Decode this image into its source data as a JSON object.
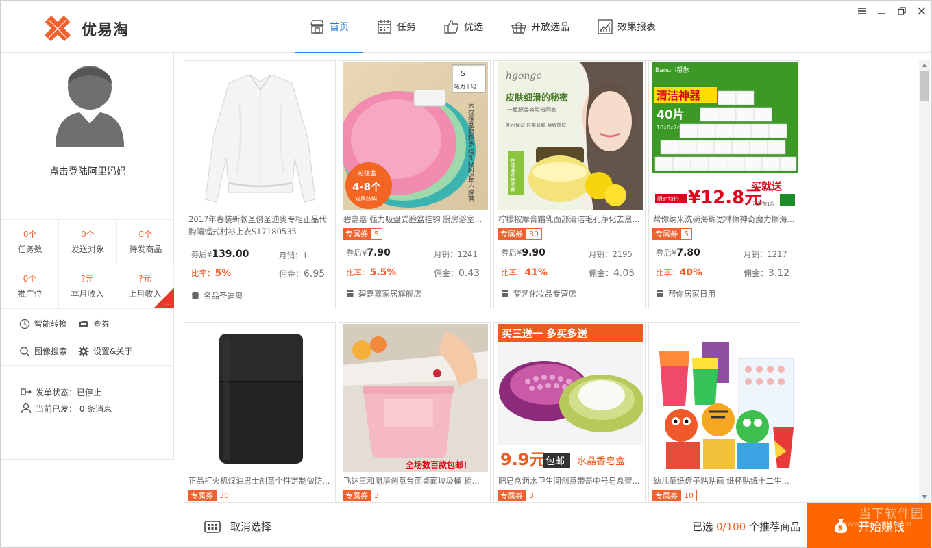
{
  "app": {
    "name": "优易淘",
    "brand_color": "#f0612d",
    "accent_color": "#2c7bd6"
  },
  "nav": [
    {
      "label": "首页",
      "icon": "store-icon",
      "active": true
    },
    {
      "label": "任务",
      "icon": "calendar-icon",
      "active": false
    },
    {
      "label": "优选",
      "icon": "thumbs-up-icon",
      "active": false
    },
    {
      "label": "开放选品",
      "icon": "basket-icon",
      "active": false
    },
    {
      "label": "效果报表",
      "icon": "chart-report-icon",
      "active": false
    }
  ],
  "window_controls": [
    "menu-icon",
    "minimize-icon",
    "restore-icon",
    "close-icon"
  ],
  "user": {
    "login_prompt": "点击登陆阿里妈妈"
  },
  "stats": [
    {
      "value": "0个",
      "label": "任务数"
    },
    {
      "value": "0个",
      "label": "发送对象"
    },
    {
      "value": "0个",
      "label": "待发商品"
    },
    {
      "value": "0个",
      "label": "推广位"
    },
    {
      "value": "?元",
      "label": "本月收入"
    },
    {
      "value": "?元",
      "label": "上月收入"
    }
  ],
  "corner_more": "...",
  "tools": [
    {
      "label": "智能转换",
      "icon": "clock-icon"
    },
    {
      "label": "查券",
      "icon": "ticket-icon"
    },
    {
      "label": "图像搜索",
      "icon": "search-icon"
    },
    {
      "label": "设置&关于",
      "icon": "gear-icon"
    }
  ],
  "status": {
    "send_state": "发单状态：已停止",
    "sent_today": "当前已发： 0  条消息"
  },
  "products": [
    {
      "title": "2017年春装新款圣创圣迪奥专柜正品代购蝙蝠式村衫上衣S17180535",
      "coupon": "",
      "price_label": "券后¥",
      "price": "139.00",
      "sales": "月销：1",
      "rate_label": "比率：",
      "rate": "5%",
      "commission_label": "佣金：",
      "commission": "6.95",
      "shop": "名品圣迪奥"
    },
    {
      "title": "碧嘉嘉 强力吸盘式脸盆挂钩 厨房浴室...",
      "coupon": "5",
      "price_label": "券后¥",
      "price": "7.90",
      "sales": "月销：1241",
      "rate_label": "比率：",
      "rate": "5.5%",
      "commission_label": "佣金：",
      "commission": "0.43",
      "shop": "碧嘉嘉家居旗舰店"
    },
    {
      "title": "柠檬按摩膏霜乳面部清洁毛孔净化去黑...",
      "coupon": "30",
      "price_label": "券后¥",
      "price": "9.90",
      "sales": "月销：2195",
      "rate_label": "比率：",
      "rate": "41%",
      "commission_label": "佣金：",
      "commission": "4.05",
      "shop": "梦艺化妆品专营店"
    },
    {
      "title": "帮你纳米洗碗海绵宽林擦神奇魔力擦海...",
      "coupon": "5",
      "price_label": "券后¥",
      "price": "7.80",
      "sales": "月销：1217",
      "rate_label": "比率：",
      "rate": "40%",
      "commission_label": "佣金：",
      "commission": "3.12",
      "shop": "帮你居家日用"
    },
    {
      "title": "正品打火机煤油男士创意个性定制做防...",
      "coupon": "30"
    },
    {
      "title": "飞达三和厨房创意台面桌面垃圾桶 橱...",
      "coupon": "3"
    },
    {
      "title": "肥皂盒沥水卫生间创意带盖中号皂盒架...",
      "coupon": "3"
    },
    {
      "title": "幼儿童纸盘子粘贴画 纸杯贴纸十二生...",
      "coupon": "10"
    }
  ],
  "coupon_tag": "专属券",
  "product_images": {
    "p2_badge_top": "可挂盆",
    "p2_badge_mid": "4-8个",
    "p2_badge_bot": "双层结构",
    "p2_brand": "吸力十足",
    "p2_vertical": "不仅挂盆稳超多 持久吸附5年不脱落",
    "p3_brand": "hgongc",
    "p3_headline": "皮肤细滑的秘密",
    "p3_sub": "一瓶肥美容院带回家",
    "p3_features": "补水保湿   自蓄肌肤   紧致饱肤",
    "p3_jar": "柠檬嫩肤按摩膏",
    "p4_brand": "Bangni帮你",
    "p4_title": "清洁神器",
    "p4_count": "40片",
    "p4_size": "10x6x2cm",
    "p4_price": "¥12.8元",
    "p4_promo": "买就送",
    "p4_limit": "限时特价",
    "p4_gift": "百洁布1片",
    "p6_banner": "全场数百款包邮！",
    "p7_banner": "买三送一 多买多送",
    "p7_price": "9.9元",
    "p7_ship": "包邮",
    "p7_name": "水晶香皂盒"
  },
  "bottom": {
    "cancel_label": "取消选择",
    "selected_prefix": "已选 ",
    "selected_count": "0/100",
    "selected_suffix": " 个推荐商品",
    "start_label": "开始赚钱",
    "watermark": "当下软件园",
    "watermark_url": "www.downxia.com"
  }
}
